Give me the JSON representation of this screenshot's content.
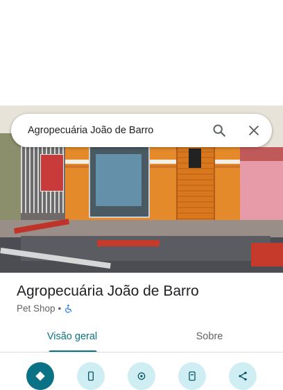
{
  "search": {
    "query": "Agropecuária João de Barro"
  },
  "place": {
    "name": "Agropecuária João de Barro",
    "category": "Pet Shop",
    "separator": "•"
  },
  "tabs": [
    {
      "label": "Visão geral",
      "active": true
    },
    {
      "label": "Sobre",
      "active": false
    }
  ],
  "actions": [
    {
      "icon": "directions-icon"
    },
    {
      "icon": "phone-icon"
    },
    {
      "icon": "location-icon"
    },
    {
      "icon": "save-icon"
    },
    {
      "icon": "share-icon"
    }
  ],
  "colors": {
    "accent": "#0b7285",
    "action_bg": "#cfeef3",
    "accessible_icon": "#1a73e8"
  }
}
